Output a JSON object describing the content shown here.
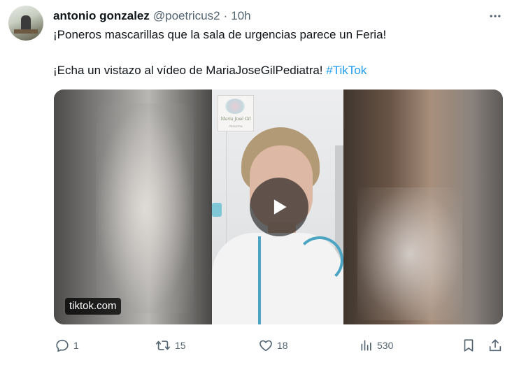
{
  "tweet": {
    "author_name": "antonio gonzalez",
    "author_handle": "@poetricus2",
    "separator": "·",
    "time": "10h",
    "more_icon": "more-horizontal-icon",
    "text_line1": "¡Poneros mascarillas que la sala de urgencias parece un Feria!",
    "text_line2": "¡Echa un vistazo al vídeo de MariaJoseGilPediatra!",
    "hashtag": "#TikTok",
    "hashtag_color": "#1d9bf0"
  },
  "media": {
    "type": "video",
    "source_label": "tiktok.com",
    "play_icon": "play-icon",
    "logo_text": "Maria José Gil",
    "logo_subtext": "PEDIATRA"
  },
  "actions": {
    "reply": {
      "icon": "reply-icon",
      "count": "1"
    },
    "retweet": {
      "icon": "retweet-icon",
      "count": "15"
    },
    "like": {
      "icon": "heart-icon",
      "count": "18"
    },
    "views": {
      "icon": "views-icon",
      "count": "530"
    },
    "bookmark": {
      "icon": "bookmark-icon"
    },
    "share": {
      "icon": "share-icon"
    },
    "icon_color": "#536471"
  }
}
